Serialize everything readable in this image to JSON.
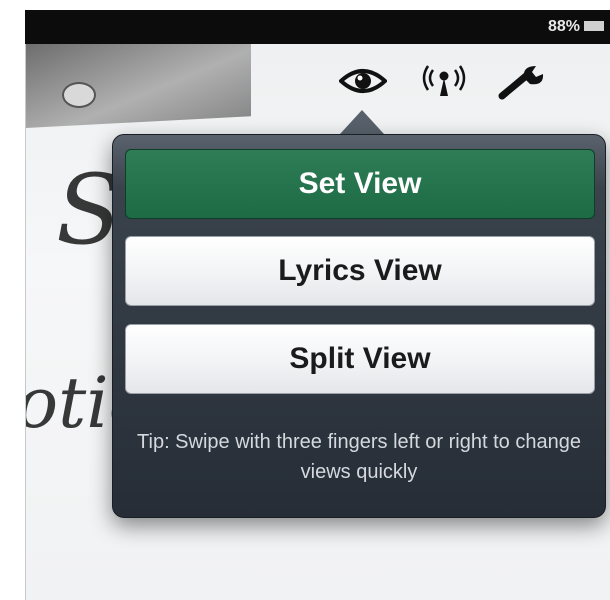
{
  "status_bar": {
    "battery_percent": "88%",
    "battery_icon": "battery-icon"
  },
  "background": {
    "handwriting_line1": "Set li",
    "handwriting_line2": "otice"
  },
  "toolbar": {
    "icons": [
      "eye-icon",
      "antenna-icon",
      "wrench-icon"
    ]
  },
  "popover": {
    "items": [
      {
        "label": "Set View",
        "selected": true
      },
      {
        "label": "Lyrics View",
        "selected": false
      },
      {
        "label": "Split View",
        "selected": false
      }
    ],
    "tip": "Tip: Swipe with three fingers left or right to change views quickly"
  },
  "colors": {
    "selected_green": "#1d6b44",
    "popover_dark": "#262d36",
    "status_bar": "#0c0c0c"
  }
}
